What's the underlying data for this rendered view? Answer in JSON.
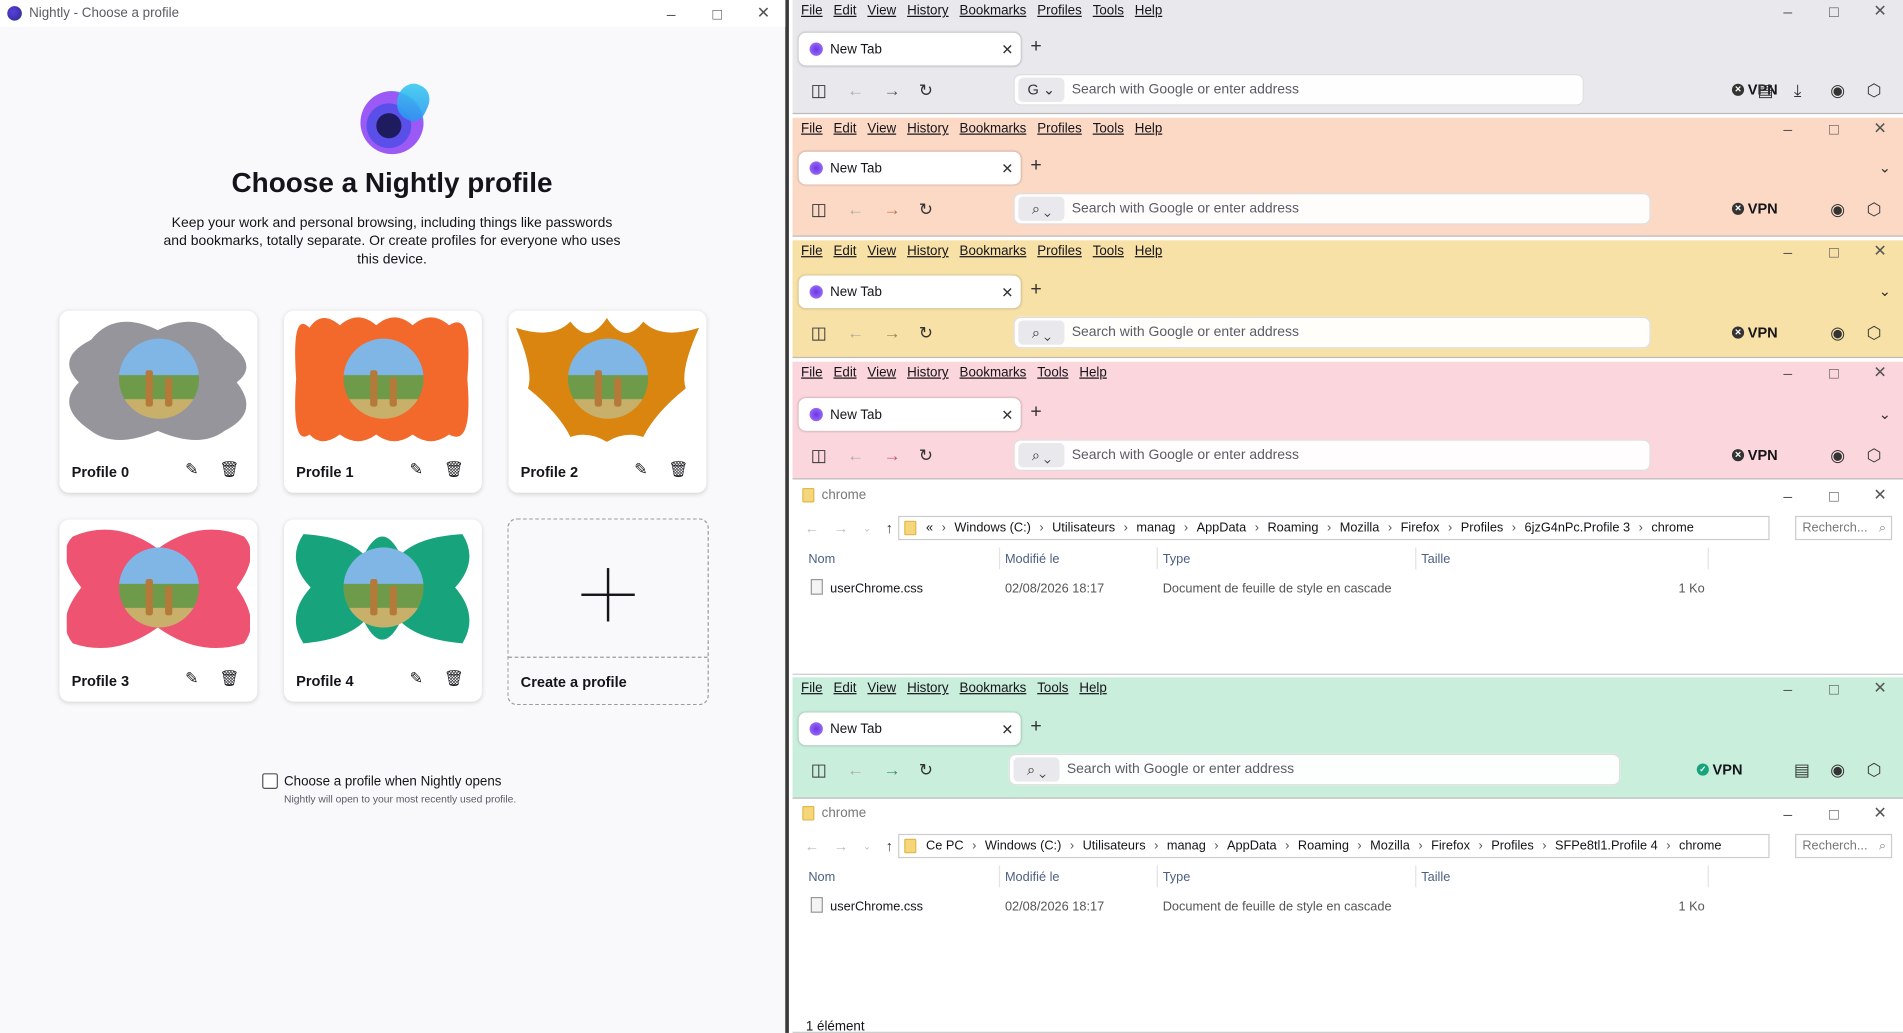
{
  "profile_manager": {
    "window_title": "Nightly - Choose a profile",
    "heading": "Choose a Nightly profile",
    "description": "Keep your work and personal browsing, including things like passwords and bookmarks, totally separate. Or create profiles for everyone who uses this device.",
    "profiles": [
      {
        "name": "Profile 0",
        "color": "#96959b"
      },
      {
        "name": "Profile 1",
        "color": "#f2692b"
      },
      {
        "name": "Profile 2",
        "color": "#d98510"
      },
      {
        "name": "Profile 3",
        "color": "#ee5371"
      },
      {
        "name": "Profile 4",
        "color": "#17a47c"
      }
    ],
    "create_label": "Create a profile",
    "checkbox_label": "Choose a profile when Nightly opens",
    "checkbox_sub": "Nightly will open to your most recently used profile.",
    "checkbox_checked": false
  },
  "menu_full": [
    "File",
    "Edit",
    "View",
    "History",
    "Bookmarks",
    "Profiles",
    "Tools",
    "Help"
  ],
  "menu_short": [
    "File",
    "Edit",
    "View",
    "History",
    "Bookmarks",
    "Tools",
    "Help"
  ],
  "tab_label": "New Tab",
  "url_placeholder": "Search with Google or enter address",
  "vpn_label": "VPN",
  "browser_colors": [
    "#e9e9ed",
    "#fbd9c4",
    "#f8e1a6",
    "#fbd6dc",
    "#c9eedc"
  ],
  "explorer": {
    "title": "chrome",
    "search_placeholder": "Recherch...",
    "columns": [
      "Nom",
      "Modifié le",
      "Type",
      "Taille"
    ],
    "file": {
      "name": "userChrome.css",
      "modified": "02/08/2026 18:17",
      "type": "Document de feuille de style en cascade",
      "size": "1 Ko"
    },
    "path1": [
      "«",
      "Windows (C:)",
      "Utilisateurs",
      "manag",
      "AppData",
      "Roaming",
      "Mozilla",
      "Firefox",
      "Profiles",
      "6jzG4nPc.Profile 3",
      "chrome"
    ],
    "path2": [
      "Ce PC",
      "Windows (C:)",
      "Utilisateurs",
      "manag",
      "AppData",
      "Roaming",
      "Mozilla",
      "Firefox",
      "Profiles",
      "SFPe8tl1.Profile 4",
      "chrome"
    ],
    "status": "1 élément"
  }
}
